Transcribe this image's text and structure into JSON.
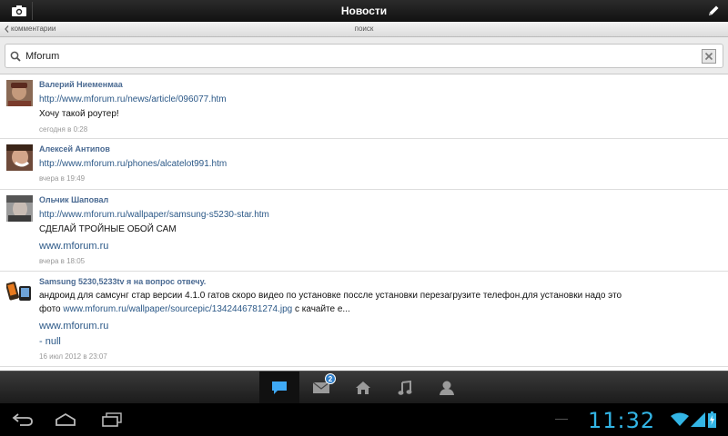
{
  "title_bar": {
    "title": "Новости"
  },
  "sub_bar": {
    "back_label": "комментарии",
    "center_label": "поиск"
  },
  "search": {
    "value": "Mforum"
  },
  "feed": [
    {
      "author": "Валерий Ниеменмаа",
      "link": "http://www.mforum.ru/news/article/096077.htm",
      "text": "Хочу такой роутер!",
      "time": "сегодня в 0:28"
    },
    {
      "author": "Алексей Антипов",
      "link": "http://www.mforum.ru/phones/alcatelot991.htm",
      "time": "вчера в 19:49"
    },
    {
      "author": "Ольчик Шаповал",
      "link": "http://www.mforum.ru/wallpaper/samsung-s5230-star.htm",
      "text": "СДЕЛАЙ ТРОЙНЫЕ ОБОЙ САМ",
      "site": "www.mforum.ru",
      "time": "вчера в 18:05"
    },
    {
      "author": "Samsung 5230,5233tv я на вопрос отвечу.",
      "text_line1": "андроид для самсунг стар версии 4.1.0 гатов скоро видео по установке поссле установки перезагрузите телефон.для установки надо это",
      "text_line2_prefix": "фото ",
      "text_line2_link": "www.mforum.ru/wallpaper/sourcepic/1342446781274.jpg",
      "text_line2_suffix": " с качайте е...",
      "site": "www.mforum.ru",
      "extra": "- null",
      "time": "16 июл 2012 в 23:07"
    }
  ],
  "tabs": {
    "messages_badge": "2"
  },
  "status": {
    "clock": "11:32"
  },
  "colors": {
    "accent": "#33b5e5",
    "link": "#2b5887",
    "author": "#4a6a92"
  }
}
